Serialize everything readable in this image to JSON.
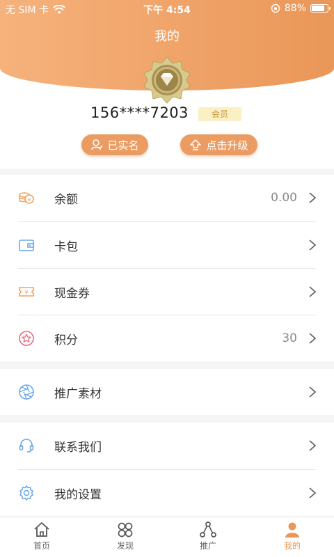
{
  "status_bar": {
    "carrier": "无 SIM 卡",
    "time": "下午 4:54",
    "battery": "88%",
    "battery_level": 0.88
  },
  "header": {
    "title": "我的"
  },
  "profile": {
    "phone": "156****7203",
    "member_label": "会员",
    "verified_label": "已实名",
    "upgrade_label": "点击升级"
  },
  "menu": {
    "balance": {
      "label": "余额",
      "value": "0.00",
      "icon": "coins-icon",
      "color": "#f0a35c"
    },
    "card_wallet": {
      "label": "卡包",
      "icon": "wallet-icon",
      "color": "#6aa8e8"
    },
    "cash_coupon": {
      "label": "现金券",
      "icon": "coupon-icon",
      "color": "#f0a35c"
    },
    "points": {
      "label": "积分",
      "value": "30",
      "icon": "star-icon",
      "color": "#e86a7a"
    },
    "promo_material": {
      "label": "推广素材",
      "icon": "aperture-icon",
      "color": "#6aa8e8"
    },
    "contact_us": {
      "label": "联系我们",
      "icon": "headset-icon",
      "color": "#6aa8e8"
    },
    "settings": {
      "label": "我的设置",
      "icon": "gear-icon",
      "color": "#6aa8e8"
    }
  },
  "tabbar": {
    "home": "首页",
    "discover": "发现",
    "promote": "推广",
    "mine": "我的"
  },
  "colors": {
    "accent": "#ea9758",
    "header_start": "#f6b27c"
  }
}
